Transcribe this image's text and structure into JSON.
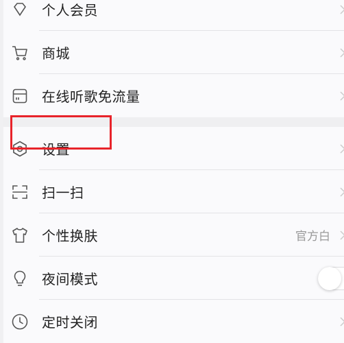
{
  "menu": {
    "group1": {
      "items": [
        {
          "label": "个人会员"
        },
        {
          "label": "商城"
        },
        {
          "label": "在线听歌免流量"
        }
      ]
    },
    "group2": {
      "items": [
        {
          "label": "设置"
        },
        {
          "label": "扫一扫"
        },
        {
          "label": "个性换肤",
          "value": "官方白"
        },
        {
          "label": "夜间模式",
          "toggle_state": "off"
        },
        {
          "label": "定时关闭"
        }
      ]
    }
  },
  "colors": {
    "highlight_border": "#e8232a",
    "background": "#fafafc",
    "divider": "#e3e3e6"
  }
}
